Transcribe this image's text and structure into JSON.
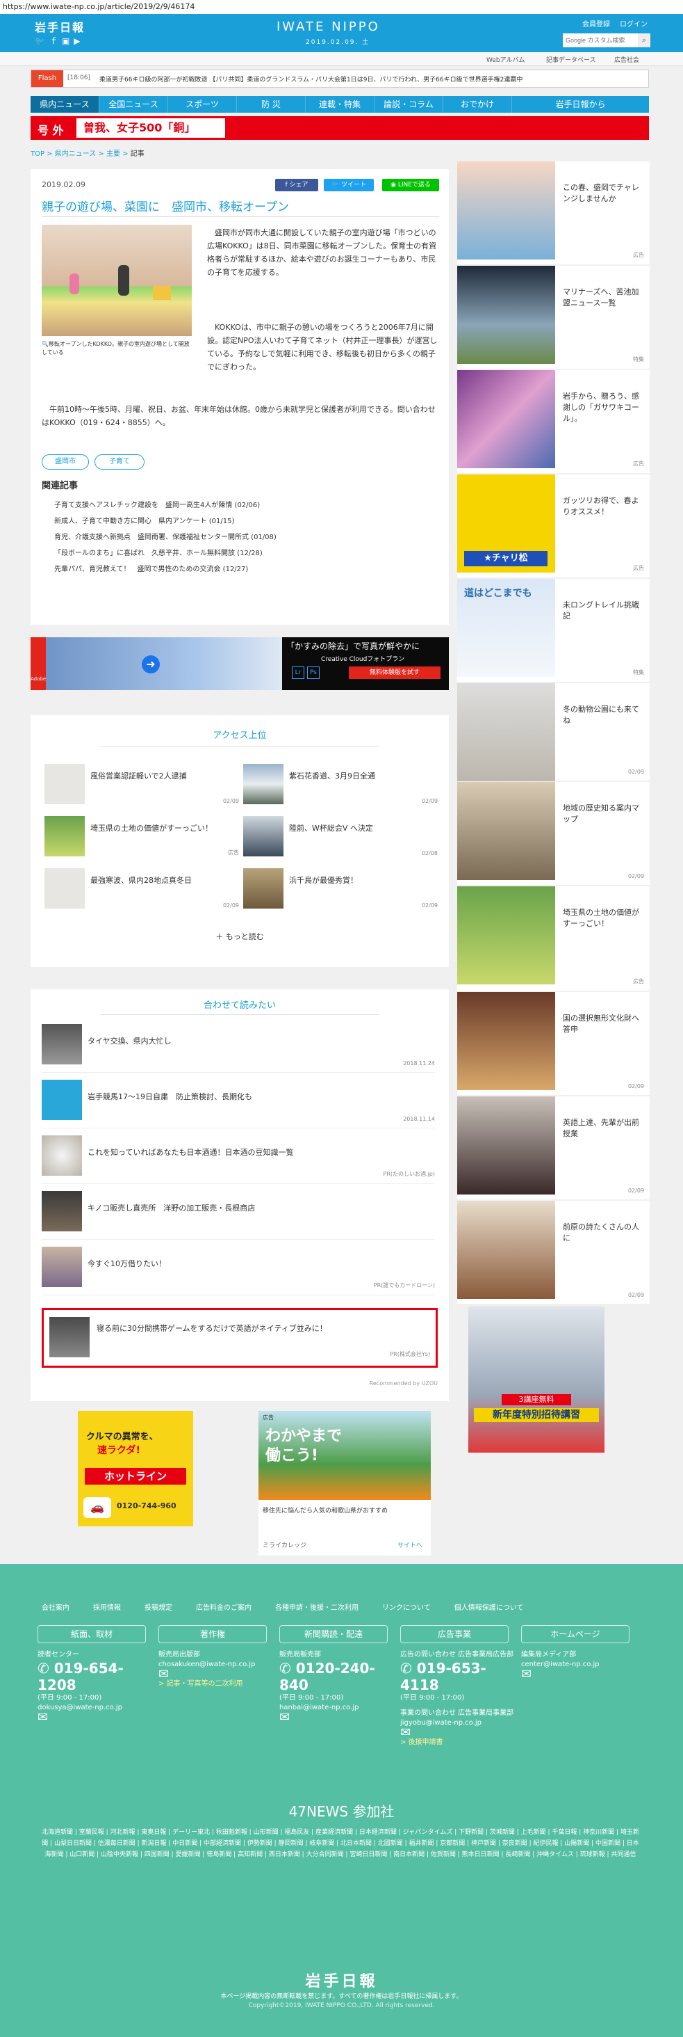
{
  "browser": {
    "url": "https://www.iwate-np.co.jp/article/2019/2/9/46174"
  },
  "header": {
    "logo": "岩手日報",
    "site_name": "IWATE NIPPO",
    "date": "2019.02.09. 土",
    "links": [
      "会員登録",
      "ログイン"
    ],
    "search_placeholder": "Google カスタム検索",
    "sub_links": [
      "Webアルバム",
      "記事データベース",
      "広告社会"
    ]
  },
  "flash": {
    "label": "Flash",
    "time": "[18:06]",
    "text": "柔道男子66キロ級の阿部一が初戦敗退 【パリ共同】柔道のグランドスラム・パリ大会第1日は9日、パリで行われ、男子66キロ級で世界選手権2連覇中"
  },
  "nav": {
    "items": [
      "県内ニュース",
      "全国ニュース",
      "スポーツ",
      "防 災",
      "連載・特集",
      "論説・コラム",
      "おでかけ",
      "岩手日報から"
    ]
  },
  "gogai": {
    "label": "号 外",
    "headline": "曽我、女子500「銅」"
  },
  "breadcrumb": [
    "TOP",
    "県内ニュース",
    "主要",
    "記事"
  ],
  "article": {
    "date": "2019.02.09",
    "share": [
      "シェア",
      "ツイート",
      "LINEで送る"
    ],
    "title": "親子の遊び場、菜園に　盛岡市、移転オープン",
    "caption": "移転オープンしたKOKKO。親子の室内遊び場として開放している",
    "body": [
      "盛岡市が同市大通に開設していた親子の室内遊び場「市つどいの広場KOKKO」は8日、同市菜園に移転オープンした。保育士の有資格者らが常駐するほか、絵本や遊びのお誕生コーナーもあり、市民の子育てを応援する。",
      "KOKKOは、市中に親子の憩いの場をつくろうと2006年7月に開設。認定NPO法人いわて子育てネット（村井正一理事長）が運営している。予約なしで気軽に利用でき、移転後も初日から多くの親子でにぎわった。",
      "午前10時〜午後5時、月曜、祝日、お盆、年末年始は休館。0歳から未就学児と保護者が利用できる。問い合わせはKOKKO（019・624・8855）へ。"
    ],
    "tags": [
      "盛岡市",
      "子育て"
    ],
    "related_title": "関連記事",
    "related": [
      "子育て支援へアスレチック建設を　盛岡一高生4人が陳情 (02/06)",
      "新成人、子育て中動き方に関心　県内アンケート (01/15)",
      "育児、介護支援へ新拠点　盛岡南署、保護福祉センター開所式 (01/08)",
      "「段ボールのまち」に喜ばれ　久慈平井、ホール無料開放 (12/28)",
      "先輩パパ、育児教えて！　盛岡で男性のための交流会 (12/27)"
    ]
  },
  "banner_ad": {
    "title": "「かすみの除去」で写真が鮮やかに",
    "sub": "Creative Cloudフォトプラン",
    "cta": "無料体験版を試す",
    "brand": "Adobe"
  },
  "access": {
    "title": "アクセス上位",
    "more": "もっと読む",
    "items": [
      {
        "title": "風俗営業認証軽いで2人逮捕",
        "date": "02/09"
      },
      {
        "title": "紫石花香道、3月9日全通",
        "date": "02/09"
      },
      {
        "title": "埼玉県の土地の価値がすーっごい！",
        "date": "広告"
      },
      {
        "title": "陸前、W杯総会V へ決定",
        "date": "02/08"
      },
      {
        "title": "最強寒波、県内28地点真冬日",
        "date": "02/09"
      },
      {
        "title": "浜千鳥が最優秀賞！",
        "date": "02/09"
      }
    ]
  },
  "recommend": {
    "title": "合わせて読みたい",
    "items": [
      {
        "title": "タイヤ交換、県内大忙し",
        "date": "2018.11.24"
      },
      {
        "title": "岩手競馬17〜19日自粛　防止策検討、長期化も",
        "date": "2018.11.14"
      },
      {
        "title": "これを知っていればあなたも日本酒通！日本酒の豆知識一覧",
        "date": "PR(たのしいお酒.jp)"
      },
      {
        "title": "キノコ販売し直売所　洋野の加工販売・長根商店",
        "date": ""
      },
      {
        "title": "今すぐ10万借りたい！",
        "date": "PR(誰でもカードローン)"
      },
      {
        "title": "寝る前に30分間携帯ゲームをするだけで英語がネイティブ並みに！",
        "date": "PR(株式会社Ys)"
      }
    ],
    "credit": "Recommended by UZOU"
  },
  "ads": {
    "left": {
      "t1": "クルマの異常を、",
      "t2": "速ラクダ!",
      "t3": "ホットライン",
      "phone": "0120-744-960"
    },
    "mid": {
      "label": "広告",
      "t1": "わかやまで",
      "t2": "働こう!",
      "t3": "移住先に悩んだら人気の和歌山県がおすすめ",
      "src": "ミライカレッジ",
      "link": "サイトへ"
    }
  },
  "sidebar": [
    {
      "text": "この春、盛岡でチャレンジしませんか",
      "meta": "広告"
    },
    {
      "text": "マリナーズへ、苦池加盟ニュース一覧",
      "meta": "特集"
    },
    {
      "text": "岩手から、贈ろう、感謝しの「ガサワキコール」。",
      "meta": "広告"
    },
    {
      "text": "ガッツリお得で、春よりオススメ！",
      "meta": "広告"
    },
    {
      "text": "未ロングトレイル挑戦記",
      "meta": "特集"
    },
    {
      "text": "冬の動物公園にも来てね",
      "meta": "02/09"
    },
    {
      "text": "地域の歴史知る案内マップ",
      "meta": "02/09"
    },
    {
      "text": "埼玉県の土地の価値がすーっごい！",
      "meta": "広告"
    },
    {
      "text": "国の選択無形文化財へ答申",
      "meta": "02/09"
    },
    {
      "text": "英語上達、先輩が出前授業",
      "meta": "02/09"
    },
    {
      "text": "前原の詩たくさんの人に",
      "meta": "02/09"
    }
  ],
  "sidebar_ad": {
    "t1": "新年度特別招待講習",
    "t2": "3講座無料"
  },
  "footer": {
    "links": [
      "会社案内",
      "採用情報",
      "投稿規定",
      "広告料金のご案内",
      "各種申請・後援・二次利用",
      "リンクについて",
      "個人情報保護について"
    ],
    "heads": [
      "紙面、取材",
      "著作権",
      "新聞購読・配達",
      "広告事業",
      "ホームページ"
    ],
    "cols": [
      {
        "label": "読者センター",
        "phone": "019-654-1208",
        "hours": "(平日 9:00 - 17:00)",
        "email": "dokusya@iwate-np.co.jp"
      },
      {
        "label": "販売局出版部",
        "email": "chosakuken@iwate-np.co.jp",
        "link": "> 記事・写真等の二次利用"
      },
      {
        "label": "販売局販売部",
        "phone": "0120-240-840",
        "hours": "(平日 9:00 - 17:00)",
        "email": "hanbai@iwate-np.co.jp"
      },
      {
        "label": "広告の問い合わせ 広告事業局広告部",
        "phone": "019-653-4118",
        "hours": "(平日 9:00 - 17:00)",
        "label2": "事業の問い合わせ 広告事業局事業部",
        "email": "jigyobu@iwate-np.co.jp",
        "link": "> 後援申請書"
      },
      {
        "label": "編集局メディア部",
        "email": "center@iwate-np.co.jp"
      }
    ],
    "partners_title": "47NEWS 参加社",
    "partners": "北海道新聞 | 室蘭民報 | 河北新報 | 東奥日報 | デーリー東北 | 秋田魁新報 | 山形新聞 | 福島民友 | 産業経済新聞 | 日本経済新聞 | ジャパンタイムズ | 下野新聞 | 茨城新聞 | 上毛新聞 | 千葉日報 | 神奈川新聞 | 埼玉新聞 | 山梨日日新聞 | 信濃毎日新聞 | 新潟日報 | 中日新聞 | 中部経済新聞 | 伊勢新聞 | 静岡新聞 | 岐阜新聞 | 北日本新聞 | 北國新聞 | 福井新聞 | 京都新聞 | 神戸新聞 | 奈良新聞 | 紀伊民報 | 山陽新聞 | 中国新聞 | 日本海新聞 | 山口新聞 | 山陰中央新報 | 四国新聞 | 愛媛新聞 | 徳島新聞 | 高知新聞 | 西日本新聞 | 大分合同新聞 | 宮崎日日新聞 | 南日本新聞 | 佐賀新聞 | 熊本日日新聞 | 長崎新聞 | 沖縄タイムス | 琉球新報 | 共同通信",
    "logo": "岩手日報",
    "notice": "本ページ掲載内容の無断転載を禁じます。すべての著作権は岩手日報社に帰属します。",
    "copyright": "Copyright©2019, IWATE NIPPO CO.,LTD. All rights reserved."
  },
  "colors": {
    "brand": "#1a9fd9",
    "accent": "#e60012",
    "footer": "#55bfa4"
  }
}
